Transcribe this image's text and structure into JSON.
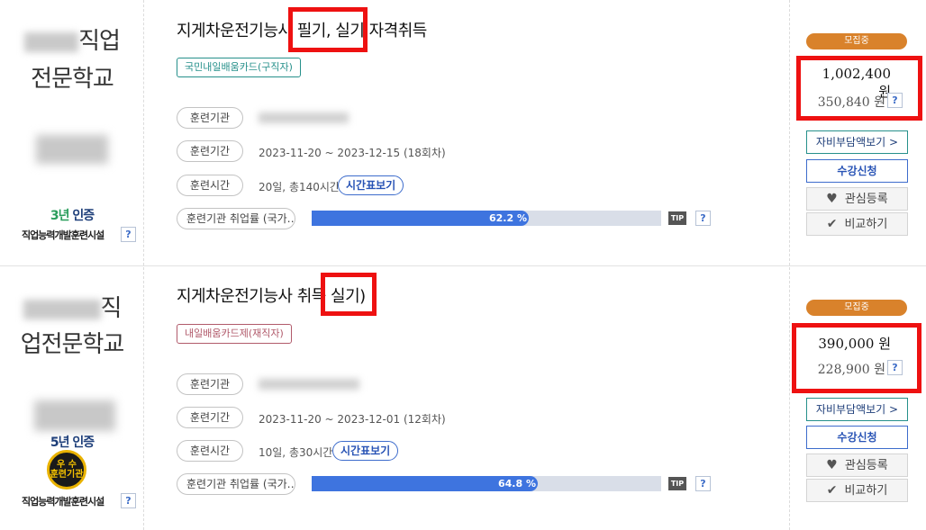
{
  "courses": [
    {
      "school_line1": "직업",
      "school_line2": "전문학교",
      "cert_years": "3년",
      "cert_suffix": " 인증",
      "facility_label": "직업능력개발훈련시설",
      "title": "지게차운전기능사 필기, 실기 자격취득",
      "tag": "국민내일배움카드(구직자)",
      "labels": {
        "org": "훈련기관",
        "period": "훈련기간",
        "hours": "훈련시간",
        "employ": "훈련기관 취업률 (국가…"
      },
      "period": "2023-11-20 ~ 2023-12-15 (18회차)",
      "hours": "20일, 총140시간",
      "timetable_button": "시간표보기",
      "employment_rate": 62.2,
      "employment_rate_label": "62.2 %",
      "status": "모집중",
      "price": "1,002,400 원",
      "self_pay": "350,840 원",
      "buttons": {
        "self_pay": "자비부담액보기 >",
        "apply": "수강신청",
        "like": "관심등록",
        "compare": "비교하기"
      }
    },
    {
      "school_line1": "직",
      "school_line2": "업전문학교",
      "cert_years": "5년",
      "cert_suffix": " 인증",
      "medal_text": "우 수\n훈련기관",
      "facility_label": "직업능력개발훈련시설",
      "title": "지게차운전기능사 취득 실기)",
      "tag": "내일배움카드제(재직자)",
      "labels": {
        "org": "훈련기관",
        "period": "훈련기간",
        "hours": "훈련시간",
        "employ": "훈련기관 취업률 (국가…"
      },
      "period": "2023-11-20 ~ 2023-12-01 (12회차)",
      "hours": "10일, 총30시간",
      "timetable_button": "시간표보기",
      "employment_rate": 64.8,
      "employment_rate_label": "64.8 %",
      "status": "모집중",
      "price": "390,000 원",
      "self_pay": "228,900 원",
      "buttons": {
        "self_pay": "자비부담액보기 >",
        "apply": "수강신청",
        "like": "관심등록",
        "compare": "비교하기"
      }
    }
  ],
  "help_glyph": "?",
  "tip_label": "TIP",
  "icons": {
    "like": "heart-icon",
    "compare": "check-icon",
    "help": "question-icon"
  },
  "colors": {
    "accent_blue": "#3e74df",
    "status_orange": "#d9822b",
    "highlight_red": "#ee1111",
    "teal": "#26908b"
  }
}
